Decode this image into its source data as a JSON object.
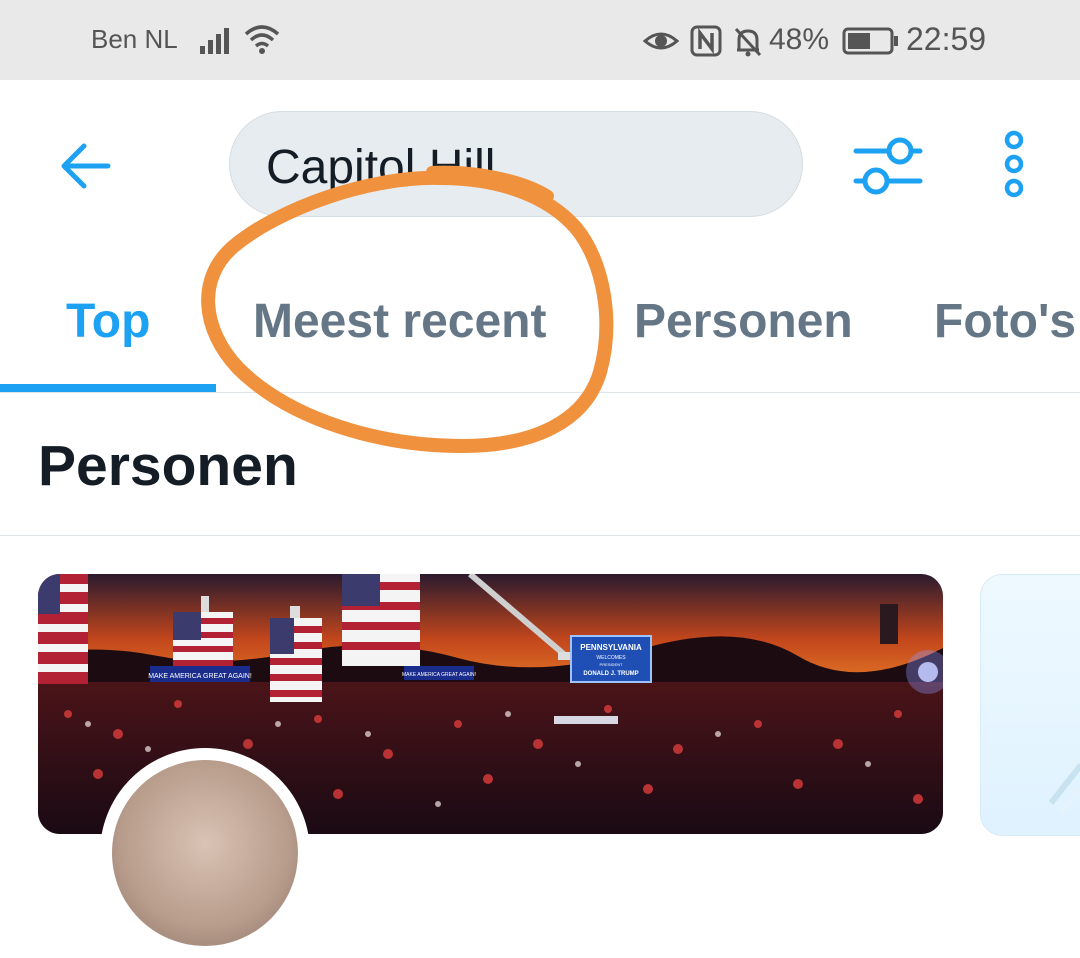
{
  "status_bar": {
    "carrier": "Ben NL",
    "battery_percent": "48%",
    "time": "22:59",
    "icons": [
      "signal-icon",
      "wifi-icon",
      "eye-icon",
      "nfc-icon",
      "bell-off-icon",
      "battery-icon"
    ]
  },
  "search": {
    "query": "Capitol Hill",
    "icons": [
      "back-arrow-icon",
      "filter-sliders-icon",
      "more-vertical-icon"
    ]
  },
  "tabs": [
    {
      "label": "Top",
      "active": true
    },
    {
      "label": "Meest recent",
      "active": false
    },
    {
      "label": "Personen",
      "active": false
    },
    {
      "label": "Foto's",
      "active": false
    }
  ],
  "section": {
    "title": "Personen"
  },
  "banner_text": {
    "sign_main": "PENNSYLVANIA",
    "sign_line2": "WELCOMES",
    "sign_line3": "PRESIDENT",
    "sign_line4": "DONALD J. TRUMP",
    "banner_left": "MAKE AMERICA GREAT AGAIN!",
    "banner_right": "MAKE AMERICA GREAT AGAIN!"
  },
  "colors": {
    "accent": "#1da1f2",
    "tab_inactive": "#657786",
    "annotation": "#f0913e"
  }
}
